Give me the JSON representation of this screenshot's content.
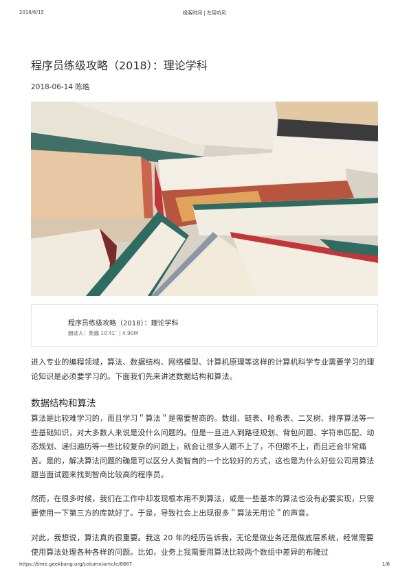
{
  "header": {
    "date": "2018/6/15",
    "site_title": "极客时间 | 左耳听风"
  },
  "article": {
    "title": "程序员练级攻略（2018）：理论学科",
    "meta": "2018-06-14 陈皓"
  },
  "audio": {
    "title": "程序员练级攻略（2018）：理论学科",
    "meta": "朗读人：柴巍    10′41′′ | 4.90M"
  },
  "content": {
    "intro": "进入专业的编程领域，算法、数据结构、网络模型、计算机原理等这样的计算机科学专业需要学习的理论知识是必须要学习的。下面我们先来讲述数据结构和算法。",
    "section_heading": "数据结构和算法",
    "para1": "算法是比较难学习的，而且学习＂算法＂是需要智商的。数组、链表、哈希表、二叉树、排序算法等一些基础知识，对大多数人来说是没什么问题的。但是一旦进入到路径规划、背包问题、字符串匹配、动态规划、递归遍历等一些比较复杂的问题上，就会让很多人跟不上了，不但跟不上，而且还会非常痛苦。是的，解决算法问题的确是可以区分人类智商的一个比较好的方式，这也是为什么好些公司用算法题当面试题来找到智商比较高的程序员。",
    "para2": "然而，在很多时候，我们在工作中却发现根本用不到算法，或是一些基本的算法也没有必要实现，只需要使用一下第三方的库就好了。于是，导致社会上出现很多＂算法无用论＂的声音。",
    "para3": "对此，我想说，算法真的很重要。我这 20 年的经历告诉我，无论是做业务还是做底层系统，经常需要使用算法处理各种各样的问题。比如，业务上我需要用算法比较两个数组中差异的布隆过"
  },
  "footer": {
    "url": "https://time.geekbang.org/column/article/8887",
    "page": "1/8"
  }
}
